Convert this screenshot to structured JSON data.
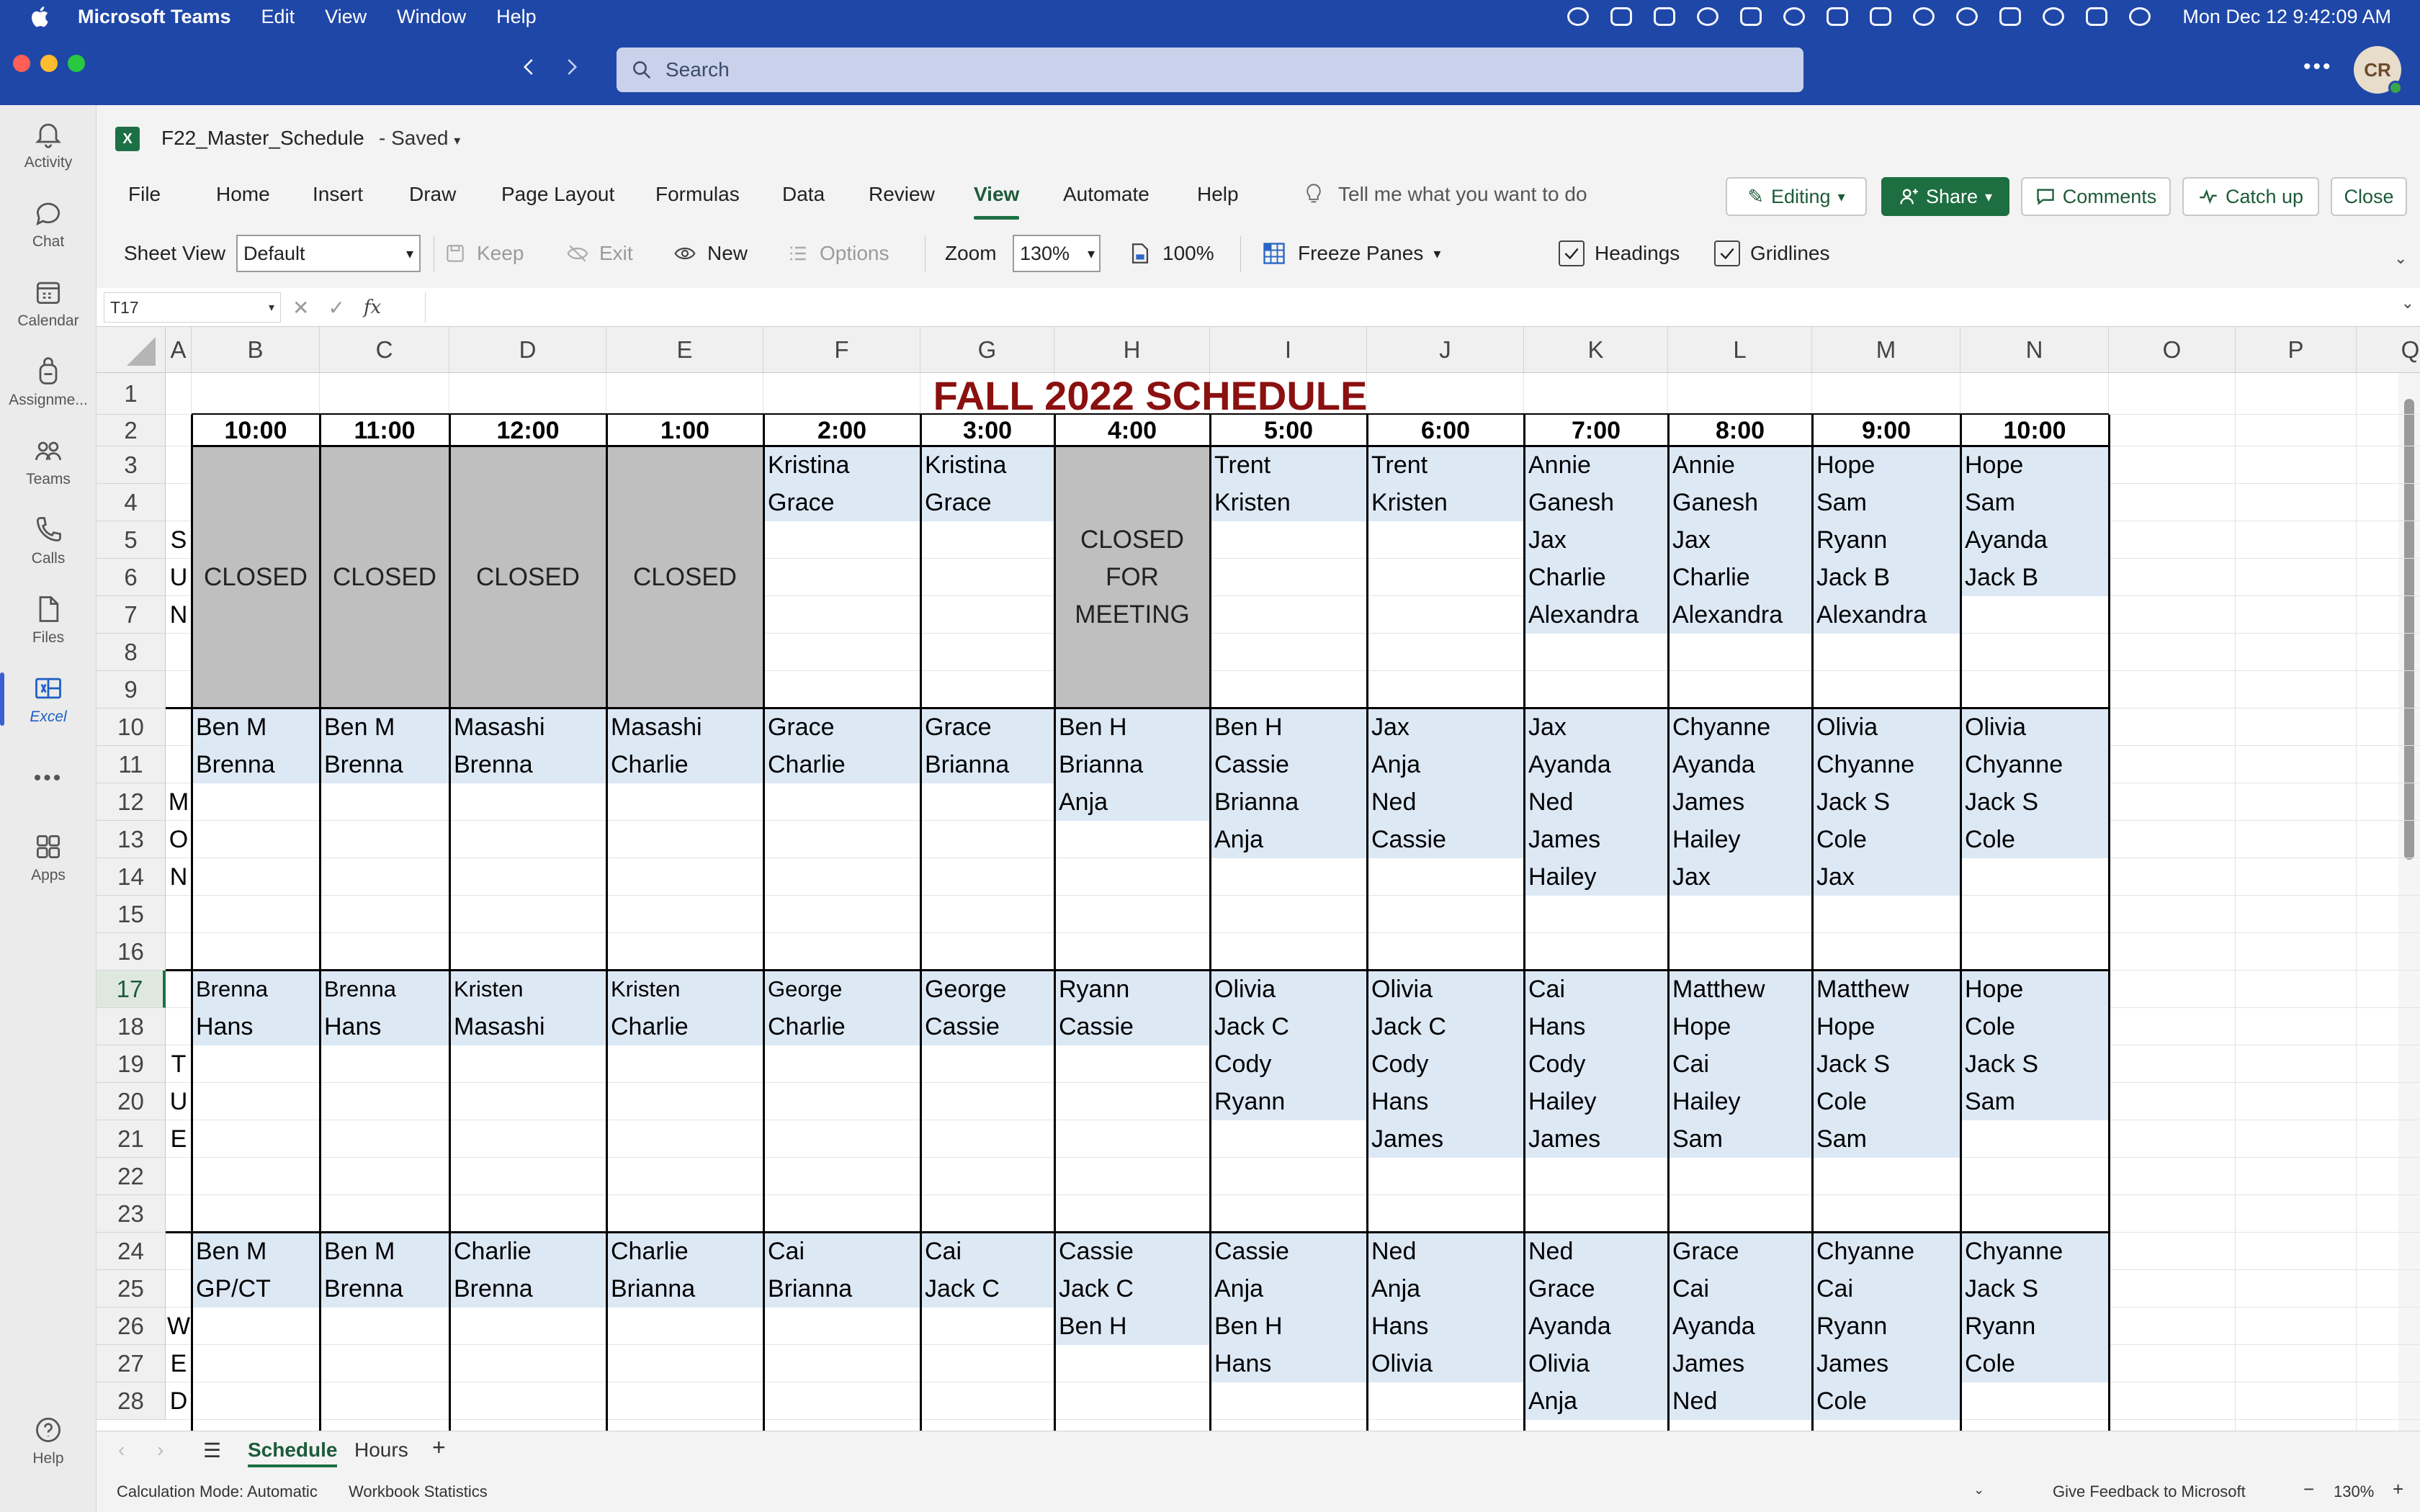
{
  "menubar": {
    "app": "Microsoft Teams",
    "items": [
      "Edit",
      "View",
      "Window",
      "Help"
    ],
    "clock": "Mon Dec 12  9:42:09 AM"
  },
  "titlebar": {
    "search_placeholder": "Search",
    "avatar": "CR"
  },
  "rail": [
    {
      "label": "Activity",
      "icon": "bell-icon"
    },
    {
      "label": "Chat",
      "icon": "chat-icon"
    },
    {
      "label": "Calendar",
      "icon": "calendar-icon"
    },
    {
      "label": "Assignme...",
      "icon": "backpack-icon"
    },
    {
      "label": "Teams",
      "icon": "people-icon"
    },
    {
      "label": "Calls",
      "icon": "phone-icon"
    },
    {
      "label": "Files",
      "icon": "file-icon"
    },
    {
      "label": "Excel",
      "icon": "excel-icon"
    },
    {
      "label": "Apps",
      "icon": "apps-icon"
    },
    {
      "label": "Help",
      "icon": "help-icon"
    }
  ],
  "excel": {
    "file_title": "F22_Master_Schedule",
    "file_status": "-  Saved",
    "tabs": [
      "File",
      "Home",
      "Insert",
      "Draw",
      "Page Layout",
      "Formulas",
      "Data",
      "Review",
      "View",
      "Automate",
      "Help"
    ],
    "active_tab": "View",
    "tell_me": "Tell me what you want to do",
    "buttons": {
      "editing": "Editing",
      "share": "Share",
      "comments": "Comments",
      "catch_up": "Catch up",
      "close": "Close"
    },
    "ribbon": {
      "sheet_view_label": "Sheet View",
      "sheet_view_value": "Default",
      "keep": "Keep",
      "exit": "Exit",
      "new": "New",
      "options": "Options",
      "zoom_label": "Zoom",
      "zoom_value": "130%",
      "zoom_100": "100%",
      "freeze_panes": "Freeze Panes",
      "headings": "Headings",
      "gridlines": "Gridlines"
    },
    "name_box": "T17",
    "fx": "fx"
  },
  "sheet": {
    "title": "FALL 2022 SCHEDULE",
    "columns": [
      "A",
      "B",
      "C",
      "D",
      "E",
      "F",
      "G",
      "H",
      "I",
      "J",
      "K",
      "L",
      "M",
      "N",
      "O",
      "P",
      "Q"
    ],
    "rows": [
      "1",
      "2",
      "3",
      "4",
      "5",
      "6",
      "7",
      "8",
      "9",
      "10",
      "11",
      "12",
      "13",
      "14",
      "15",
      "16",
      "17",
      "18",
      "19",
      "20",
      "21",
      "22",
      "23",
      "24",
      "25",
      "26",
      "27",
      "28"
    ],
    "times": [
      "10:00",
      "11:00",
      "12:00",
      "1:00",
      "2:00",
      "3:00",
      "4:00",
      "5:00",
      "6:00",
      "7:00",
      "8:00",
      "9:00",
      "10:00"
    ],
    "closed": "CLOSED",
    "closed_meeting": [
      "CLOSED",
      "FOR",
      "MEETING"
    ],
    "days": [
      {
        "letters": [
          "S",
          "U",
          "N"
        ],
        "cols": [
          [],
          [],
          [],
          [],
          [
            "Kristina",
            "Grace"
          ],
          [
            "Kristina",
            "Grace"
          ],
          [],
          [
            "Trent",
            "Kristen"
          ],
          [
            "Trent",
            "Kristen"
          ],
          [
            "Annie",
            "Ganesh",
            "Jax",
            "Charlie",
            "Alexandra"
          ],
          [
            "Annie",
            "Ganesh",
            "Jax",
            "Charlie",
            "Alexandra"
          ],
          [
            "Hope",
            "Sam",
            "Ryann",
            "Jack B",
            "Alexandra"
          ],
          [
            "Hope",
            "Sam",
            "Ayanda",
            "Jack B"
          ]
        ]
      },
      {
        "letters": [
          "M",
          "O",
          "N"
        ],
        "cols": [
          [
            "Ben M",
            "Brenna"
          ],
          [
            "Ben M",
            "Brenna"
          ],
          [
            "Masashi",
            "Brenna"
          ],
          [
            "Masashi",
            "Charlie"
          ],
          [
            "Grace",
            "Charlie"
          ],
          [
            "Grace",
            "Brianna"
          ],
          [
            "Ben H",
            "Brianna",
            "Anja"
          ],
          [
            "Ben H",
            "Cassie",
            "Brianna",
            "Anja"
          ],
          [
            "Jax",
            "Anja",
            "Ned",
            "Cassie"
          ],
          [
            "Jax",
            "Ayanda",
            "Ned",
            "James",
            "Hailey"
          ],
          [
            "Chyanne",
            "Ayanda",
            "James",
            "Hailey",
            "Jax"
          ],
          [
            "Olivia",
            "Chyanne",
            "Jack S",
            "Cole",
            "Jax"
          ],
          [
            "Olivia",
            "Chyanne",
            "Jack S",
            "Cole"
          ]
        ]
      },
      {
        "letters": [
          "T",
          "U",
          "E"
        ],
        "cols": [
          [
            "Brenna",
            "Hans"
          ],
          [
            "Brenna",
            "Hans"
          ],
          [
            "Kristen",
            "Masashi"
          ],
          [
            "Kristen",
            "Charlie"
          ],
          [
            "George",
            "Charlie"
          ],
          [
            "George",
            "Cassie"
          ],
          [
            "Ryann",
            "Cassie"
          ],
          [
            "Olivia",
            "Jack C",
            "Cody",
            "Ryann"
          ],
          [
            "Olivia",
            "Jack C",
            "Cody",
            "Hans",
            "James"
          ],
          [
            "Cai",
            "Hans",
            "Cody",
            "Hailey",
            "James"
          ],
          [
            "Matthew",
            "Hope",
            "Cai",
            "Hailey",
            "Sam"
          ],
          [
            "Matthew",
            "Hope",
            "Jack S",
            "Cole",
            "Sam"
          ],
          [
            "Hope",
            "Cole",
            "Jack S",
            "Sam"
          ]
        ]
      },
      {
        "letters": [
          "W",
          "E",
          "D"
        ],
        "cols": [
          [
            "Ben M",
            "GP/CT"
          ],
          [
            "Ben M",
            "Brenna"
          ],
          [
            "Charlie",
            "Brenna"
          ],
          [
            "Charlie",
            "Brianna"
          ],
          [
            "Cai",
            "Brianna"
          ],
          [
            "Cai",
            "Jack C"
          ],
          [
            "Cassie",
            "Jack C",
            "Ben H"
          ],
          [
            "Cassie",
            "Anja",
            "Ben H",
            "Hans"
          ],
          [
            "Ned",
            "Anja",
            "Hans",
            "Olivia"
          ],
          [
            "Ned",
            "Grace",
            "Ayanda",
            "Olivia",
            "Anja"
          ],
          [
            "Grace",
            "Cai",
            "Ayanda",
            "James",
            "Ned"
          ],
          [
            "Chyanne",
            "Cai",
            "Ryann",
            "James",
            "Cole"
          ],
          [
            "Chyanne",
            "Jack S",
            "Ryann",
            "Cole"
          ]
        ]
      }
    ]
  },
  "sheet_tabs": [
    "Schedule",
    "Hours"
  ],
  "status": {
    "calc": "Calculation Mode: Automatic",
    "stats": "Workbook Statistics",
    "feedback": "Give Feedback to Microsoft",
    "zoom": "130%"
  },
  "colors": {
    "brand_blue": "#1f47a8",
    "excel_green": "#1d7044",
    "closed_gray": "#bfbfbf",
    "name_fill": "#dde8f5",
    "title_red": "#8b1010"
  }
}
